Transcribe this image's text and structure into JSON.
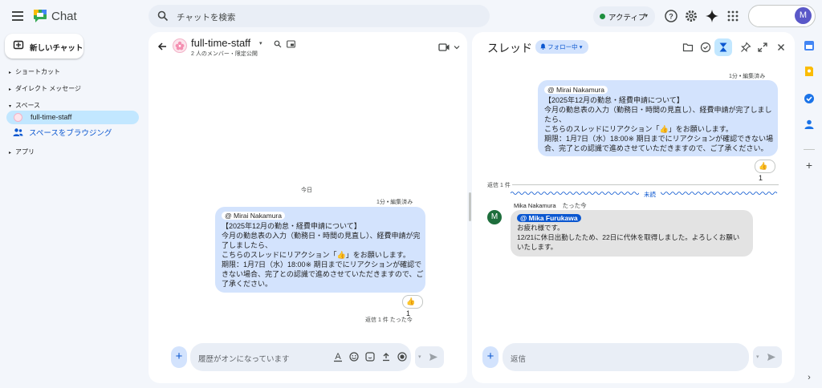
{
  "app": {
    "title": "Chat"
  },
  "search": {
    "placeholder": "チャットを検索"
  },
  "status": {
    "label": "アクティブ"
  },
  "account": {
    "initial": "M"
  },
  "nav": {
    "new_chat": "新しいチャット",
    "sections": [
      "ショートカット",
      "ダイレクト メッセージ",
      "スペース"
    ],
    "active_space": "full-time-staff",
    "browse": "スペースをブラウジング",
    "apps": "アプリ"
  },
  "space": {
    "name": "full-time-staff",
    "members": "2 人のメンバー・限定公開"
  },
  "conversation": {
    "today": "今日",
    "meta": "1分 • 編集済み",
    "mention": "@ Mirai Nakamura",
    "body": "【2025年12月の勤怠・経費申請について】\n今月の勤怠表の入力（勤務日・時間の見直し）、経費申請が完\n了しましたら、\nこちらのスレッドにリアクション「👍」をお願いします。\n期限：1月7日（水）18:00※ 期日までにリアクションが確認で\nきない場合、完了との認識で進めさせていただきますので、ご\n了承ください。",
    "reaction": "👍 1",
    "reply_info": "返信 1 件  たった今",
    "composer_placeholder": "履歴がオンになっています"
  },
  "thread": {
    "title": "スレッド",
    "follow": "フォロー中",
    "meta": "1分 • 編集済み",
    "mention": "@ Mirai Nakamura",
    "body": "【2025年12月の勤怠・経費申請について】\n今月の勤怠表の入力（勤務日・時間の見直し）、経費申請が完了しまし\nたら、\nこちらのスレッドにリアクション「👍」をお願いします。\n期限：1月7日（水）18:00※ 期日までにリアクションが確認できない場\n合、完了との認識で進めさせていただきますので、ご了承ください。",
    "reaction": "👍 1",
    "replies_count": "返信 1 件",
    "unread": "未読",
    "reply": {
      "avatar_initial": "M",
      "author": "Mika Nakamura",
      "time": "たった今",
      "mention": "@ Mika Furukawa",
      "body": "お疲れ様です。\n12/21に休日出勤したため、22日に代休を取得しました。よろしくお願い\nいたします。"
    },
    "composer_placeholder": "返信"
  },
  "colors": {
    "accent": "#0b57d0",
    "bubble": "#d3e3fd",
    "active_nav": "#c2e7ff",
    "status_green": "#1e8e3e"
  }
}
